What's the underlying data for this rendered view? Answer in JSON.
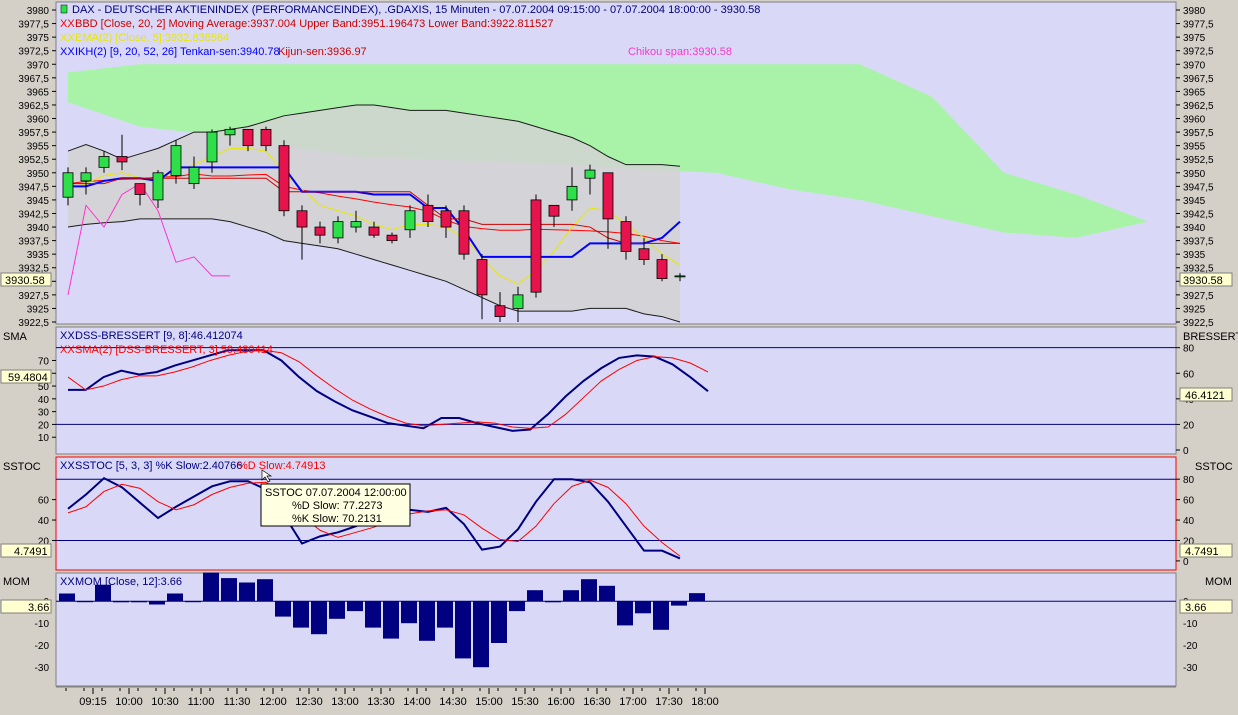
{
  "colors": {
    "plot_bg": "#d9d9f7",
    "frame_bg": "#d4d0c8",
    "up_candle": "#2de04a",
    "down_candle": "#e6134d",
    "kumo_bull": "#b3ffb3",
    "kumo_fill": "#a9f3a9",
    "band_fill": "#d2d2d2",
    "bb_middle": "#ff0000",
    "bb_bands": "#1a1a1a",
    "ema": "#e8e800",
    "tenkan": "#0000ff",
    "kijun": "#cc0000",
    "chikou": "#ff33cc",
    "dss_main": "#000080",
    "dss_sma": "#ff0000",
    "mom_bar": "#000080",
    "highlight_frame": "#ff0000",
    "value_box": "#ffffd0"
  },
  "legend": {
    "dax": "DAX - DEUTSCHER AKTIENINDEX (PERFORMANCEINDEX), .GDAXIS, 15 Minuten - 07.07.2004 09:15:00 - 07.07.2004 18:00:00 - 3930.58",
    "bbd": "BBD [Close, 20, 2] Moving Average:3937.004 Upper Band:3951.196473 Lower Band:3922.811527",
    "ema": "EMA(2) [Close, 5]:3932.836564",
    "ikh_name": "IKH(2) [9, 20, 52, 26] Tenkan-sen:3940.78",
    "ikh_kijun": "Kijun-sen:3936.97",
    "chikou": "Chikou span:3930.58",
    "dss": "DSS-BRESSERT [9, 8]:46.412074",
    "dss_sma": "SMA(2) [DSS-BRESSERT, 3]:59.480414",
    "sstoc_k": "SSTOC [5, 3, 3] %K Slow:2.40766",
    "sstoc_d": "%D Slow:4.74913",
    "mom": "MOM [Close, 12]:3.66"
  },
  "panels": {
    "dss_left_title": "SMA",
    "dss_right_title": "BRESSERT",
    "dss_left_value": "59.4804",
    "dss_right_value": "46.4121",
    "sstoc_left_title": "SSTOC",
    "sstoc_right_title": "SSTOC",
    "sstoc_left_value": "4.7491",
    "sstoc_right_value": "4.7491",
    "mom_left_title": "MOM",
    "mom_right_title": "MOM",
    "mom_left_value": "3.66",
    "mom_right_value": "3.66",
    "price_value": "3930.58"
  },
  "tooltip": {
    "title": "SSTOC  07.07.2004 12:00:00",
    "line1": "%D Slow: 77.2273",
    "line2": "%K Slow: 70.2131"
  },
  "axes": {
    "price_ticks": [
      "3980",
      "3977,5",
      "3975",
      "3972,5",
      "3970",
      "3967,5",
      "3965",
      "3962,5",
      "3960",
      "3957,5",
      "3955",
      "3952,5",
      "3950",
      "3947,5",
      "3945",
      "3942,5",
      "3940",
      "3937,5",
      "3935",
      "3932,5",
      "3930",
      "3927,5",
      "3925",
      "3922,5"
    ],
    "dss_left_ticks": [
      "70",
      "60",
      "50",
      "40",
      "30",
      "20",
      "10"
    ],
    "dss_right_ticks": [
      "80",
      "60",
      "40",
      "20",
      "0"
    ],
    "sstoc_left_ticks": [
      "60",
      "40",
      "20"
    ],
    "sstoc_right_ticks": [
      "80",
      "60",
      "40",
      "20",
      "0"
    ],
    "mom_ticks": [
      "0",
      "-0",
      "-10",
      "-20",
      "-30"
    ],
    "time_ticks": [
      "09:15",
      "10:00",
      "10:30",
      "11:00",
      "11:30",
      "12:00",
      "12:30",
      "13:00",
      "13:30",
      "14:00",
      "14:30",
      "15:00",
      "15:30",
      "16:00",
      "16:30",
      "17:00",
      "17:30",
      "18:00"
    ]
  },
  "chart_data": [
    {
      "type": "candlestick",
      "name": "DAX 15 Minuten",
      "x": [
        "09:15",
        "09:30",
        "09:45",
        "10:00",
        "10:15",
        "10:30",
        "10:45",
        "11:00",
        "11:15",
        "11:30",
        "11:45",
        "12:00",
        "12:15",
        "12:30",
        "12:45",
        "13:00",
        "13:15",
        "13:30",
        "13:45",
        "14:00",
        "14:15",
        "14:30",
        "14:45",
        "15:00",
        "15:15",
        "15:30",
        "15:45",
        "16:00",
        "16:15",
        "16:30",
        "16:45",
        "17:00",
        "17:15",
        "17:30",
        "17:45"
      ],
      "open": [
        3945.5,
        3948.5,
        3951,
        3953,
        3948,
        3945,
        3949.5,
        3948,
        3952,
        3957,
        3958,
        3958,
        3955,
        3943,
        3940,
        3938,
        3940,
        3940,
        3938.5,
        3939.5,
        3944,
        3943,
        3943,
        3934,
        3925.5,
        3925,
        3945,
        3944,
        3945,
        3949,
        3950,
        3941,
        3936,
        3934,
        3931
      ],
      "close": [
        3950,
        3950,
        3953,
        3952,
        3946,
        3950,
        3955,
        3951,
        3957.5,
        3958,
        3955,
        3955,
        3943,
        3940,
        3938.5,
        3941,
        3941,
        3938.5,
        3937.5,
        3943,
        3941,
        3940,
        3935,
        3927.5,
        3923.5,
        3927.5,
        3928,
        3942,
        3947.5,
        3950.5,
        3941.5,
        3935.5,
        3934,
        3930.5,
        3931
      ],
      "high": [
        3951,
        3951,
        3954,
        3957,
        3948,
        3950.5,
        3956,
        3953,
        3958,
        3958.5,
        3958,
        3958.5,
        3956,
        3944,
        3941,
        3942,
        3943,
        3941,
        3939,
        3944,
        3946,
        3944,
        3944,
        3935,
        3928,
        3929,
        3946,
        3944,
        3951,
        3951.5,
        3950,
        3942,
        3938,
        3935,
        3931.5
      ],
      "low": [
        3944,
        3946,
        3950,
        3950.5,
        3944,
        3943.5,
        3948,
        3947,
        3950,
        3955,
        3954,
        3954,
        3942,
        3934,
        3937,
        3937,
        3939,
        3938,
        3937,
        3938,
        3940,
        3938,
        3934,
        3923,
        3922.5,
        3922.5,
        3927,
        3940,
        3943,
        3946,
        3936,
        3934,
        3933,
        3930,
        3930
      ],
      "ylim": [
        3922.5,
        3980
      ]
    },
    {
      "type": "line",
      "name": "BBD",
      "ylim": [
        3922.5,
        3980
      ],
      "series": [
        {
          "name": "Moving Average",
          "x_index": [
            0,
            1,
            2,
            3,
            4,
            5,
            6,
            7,
            8,
            9,
            10,
            11,
            12,
            13,
            14,
            15,
            16,
            17,
            18,
            19,
            20,
            21,
            22,
            23,
            24,
            25,
            26,
            27,
            28,
            29,
            30,
            31,
            32,
            33,
            34
          ],
          "values": [
            3948,
            3948.4,
            3948.6,
            3948.8,
            3948.9,
            3949.2,
            3949.3,
            3949.8,
            3949.4,
            3949.4,
            3949.6,
            3949.7,
            3947.5,
            3946.8,
            3946.3,
            3945.7,
            3945.2,
            3944.6,
            3944.1,
            3943.7,
            3942.9,
            3941.3,
            3940.1,
            3939.7,
            3939.4,
            3939.4,
            3939.6,
            3939.5,
            3939.4,
            3939.3,
            3939.1,
            3938.8,
            3938.3,
            3937.5,
            3937
          ]
        },
        {
          "name": "Upper Band",
          "x_index": [
            0,
            1,
            2,
            3,
            4,
            5,
            6,
            7,
            8,
            9,
            10,
            11,
            12,
            13,
            14,
            15,
            16,
            17,
            18,
            19,
            20,
            21,
            22,
            23,
            24,
            25,
            26,
            27,
            28,
            29,
            30,
            31,
            32,
            33,
            34
          ],
          "values": [
            3954,
            3955.2,
            3954,
            3952.5,
            3953.5,
            3954.5,
            3956,
            3957.5,
            3957.5,
            3958,
            3958.5,
            3959.5,
            3960.5,
            3961,
            3961.5,
            3962,
            3962.5,
            3962.5,
            3962,
            3961.5,
            3961.5,
            3961.5,
            3961,
            3960.5,
            3960,
            3959.5,
            3958.5,
            3957.5,
            3956.5,
            3955,
            3953,
            3951.5,
            3951.5,
            3951.5,
            3951.2
          ]
        },
        {
          "name": "Lower Band",
          "x_index": [
            0,
            1,
            2,
            3,
            4,
            5,
            6,
            7,
            8,
            9,
            10,
            11,
            12,
            13,
            14,
            15,
            16,
            17,
            18,
            19,
            20,
            21,
            22,
            23,
            24,
            25,
            26,
            27,
            28,
            29,
            30,
            31,
            32,
            33,
            34
          ],
          "values": [
            3940,
            3940.5,
            3940.8,
            3941,
            3941.5,
            3941.5,
            3941.5,
            3941.5,
            3941.5,
            3941,
            3940,
            3939,
            3937.5,
            3937,
            3936.5,
            3936,
            3935,
            3934,
            3933,
            3932,
            3931,
            3930,
            3928.5,
            3927,
            3925.5,
            3924.5,
            3924.5,
            3924.5,
            3924.5,
            3925,
            3925,
            3925,
            3924,
            3923.5,
            3922.5
          ]
        },
        {
          "name": "EMA",
          "x_index": [
            0,
            1,
            2,
            3,
            4,
            5,
            6,
            7,
            8,
            9,
            10,
            11,
            12,
            13,
            14,
            15,
            16,
            17,
            18,
            19,
            20,
            21,
            22,
            23,
            24,
            25,
            26,
            27,
            28,
            29,
            30,
            31,
            32,
            33,
            34
          ],
          "values": [
            3947,
            3948,
            3949.5,
            3950,
            3949,
            3948.5,
            3950.5,
            3951.5,
            3953,
            3954.5,
            3954.5,
            3954,
            3950,
            3947,
            3944,
            3943,
            3942,
            3940.5,
            3939.5,
            3940.5,
            3940.5,
            3940,
            3938,
            3934.5,
            3931,
            3929.5,
            3932,
            3935.5,
            3940,
            3943.5,
            3943,
            3940.5,
            3938,
            3935,
            3933
          ]
        },
        {
          "name": "Tenkan-sen",
          "x_index": [
            0,
            1,
            2,
            3,
            4,
            5,
            6,
            7,
            8,
            9,
            10,
            11,
            12,
            13,
            14,
            15,
            16,
            17,
            18,
            19,
            20,
            21,
            22,
            23,
            24,
            25,
            26,
            27,
            28,
            29,
            30,
            31,
            32,
            33,
            34
          ],
          "values": [
            3947.5,
            3947.5,
            3948.5,
            3949,
            3949,
            3948.5,
            3951,
            3951,
            3951,
            3951,
            3951,
            3951,
            3951,
            3946.5,
            3946.5,
            3946.5,
            3946.5,
            3946,
            3946,
            3946,
            3943.5,
            3943.5,
            3939.5,
            3934.5,
            3934.5,
            3934.5,
            3934.5,
            3934.5,
            3934.5,
            3937,
            3937,
            3937,
            3937,
            3938,
            3941
          ]
        },
        {
          "name": "Kijun-sen",
          "x_index": [
            0,
            1,
            2,
            3,
            4,
            5,
            6,
            7,
            8,
            9,
            10,
            11,
            12,
            13,
            14,
            15,
            16,
            17,
            18,
            19,
            20,
            21,
            22,
            23,
            24,
            25,
            26,
            27,
            28,
            29,
            30,
            31,
            32,
            33,
            34
          ],
          "values": [
            3948,
            3948,
            3948,
            3949,
            3949,
            3949,
            3949,
            3949,
            3949,
            3949,
            3949,
            3949,
            3946.5,
            3946.5,
            3946.5,
            3946.5,
            3946.5,
            3946.5,
            3946.5,
            3946.5,
            3944,
            3941.5,
            3941.5,
            3940.5,
            3940.5,
            3940.5,
            3940.5,
            3940.5,
            3940.5,
            3940,
            3938,
            3937,
            3937,
            3937,
            3937
          ]
        },
        {
          "name": "Chikou span",
          "x_index": [
            0,
            1,
            2,
            3,
            4,
            5,
            6,
            7,
            8,
            9
          ],
          "values": [
            3927.5,
            3944,
            3940,
            3946,
            3948,
            3943,
            3933.5,
            3934.5,
            3931,
            3931
          ]
        }
      ]
    },
    {
      "type": "area",
      "name": "Ichimoku cloud",
      "ylim": [
        3922.5,
        3980
      ],
      "x_index": [
        0,
        4,
        8,
        12,
        16,
        20,
        24,
        28,
        32,
        36,
        40,
        44,
        48,
        52,
        56,
        60
      ],
      "top": [
        3968.5,
        3970,
        3970,
        3970,
        3970,
        3970,
        3970,
        3970,
        3970,
        3970,
        3970,
        3970,
        3964,
        3950,
        3946,
        3941
      ],
      "bottom": [
        3963,
        3958.5,
        3957,
        3955,
        3953,
        3952.5,
        3952,
        3951.5,
        3950.5,
        3950,
        3947,
        3945,
        3942,
        3939,
        3938,
        3941
      ]
    },
    {
      "type": "line",
      "name": "DSS-BRESSERT",
      "ylim": [
        0,
        86
      ],
      "series": [
        {
          "name": "DSS-BRESSERT",
          "values": [
            47,
            47,
            57,
            62,
            59,
            61,
            66,
            70,
            74,
            78,
            78,
            78,
            70,
            57,
            46,
            38,
            31,
            26,
            21,
            19,
            17,
            25,
            25,
            21,
            18,
            15,
            16,
            28,
            42,
            54,
            64,
            72,
            74,
            73,
            67,
            57,
            46
          ]
        },
        {
          "name": "SMA",
          "values": [
            57,
            47,
            50,
            55,
            58,
            58,
            61,
            65,
            70,
            74,
            77,
            78,
            76,
            69,
            58,
            48,
            39,
            32,
            26,
            21,
            19,
            20,
            21,
            22,
            21,
            18,
            17,
            18,
            28,
            41,
            54,
            63,
            70,
            73,
            72,
            68,
            61
          ]
        }
      ],
      "reference_lines": [
        80,
        20
      ]
    },
    {
      "type": "line",
      "name": "SSTOC",
      "ylim": [
        -5,
        89
      ],
      "series": [
        {
          "name": "%K Slow",
          "values": [
            51,
            65,
            81,
            72,
            57,
            42,
            53,
            63,
            73,
            78,
            78,
            70,
            45,
            17,
            24,
            28,
            34,
            42,
            48,
            50,
            48,
            52,
            36,
            11,
            14,
            31,
            58,
            80,
            80,
            77,
            58,
            34,
            10,
            10,
            2.4
          ]
        },
        {
          "name": "%D Slow",
          "values": [
            47,
            53,
            68,
            75,
            71,
            58,
            50,
            55,
            65,
            72,
            76,
            77,
            65,
            44,
            30,
            23,
            28,
            33,
            40,
            46,
            49,
            50,
            45,
            32,
            21,
            19,
            34,
            56,
            73,
            79,
            72,
            56,
            34,
            18,
            4.7
          ]
        }
      ],
      "reference_lines": [
        80,
        20
      ]
    },
    {
      "type": "bar",
      "name": "MOM",
      "ylim": [
        -34,
        6
      ],
      "x": [
        "09:15",
        "09:30",
        "09:45",
        "10:00",
        "10:15",
        "10:30",
        "10:45",
        "11:00",
        "11:15",
        "11:30",
        "11:45",
        "12:00",
        "12:15",
        "12:30",
        "12:45",
        "13:00",
        "13:15",
        "13:30",
        "13:45",
        "14:00",
        "14:15",
        "14:30",
        "14:45",
        "15:00",
        "15:15",
        "15:30",
        "15:45",
        "16:00",
        "16:15",
        "16:30",
        "16:45",
        "17:00",
        "17:15",
        "17:30",
        "17:45"
      ],
      "values": [
        3.5,
        0,
        7.5,
        -0.5,
        -0.5,
        -1.5,
        3.5,
        0,
        13,
        10.5,
        8.5,
        10,
        -7,
        -12,
        -15,
        -8,
        -4.5,
        -12,
        -17,
        -10,
        -18,
        -12,
        -26,
        -30,
        -19,
        -4.5,
        5,
        -0.5,
        5,
        10,
        7,
        -11,
        -5.5,
        -13,
        -2,
        3.66
      ]
    }
  ]
}
